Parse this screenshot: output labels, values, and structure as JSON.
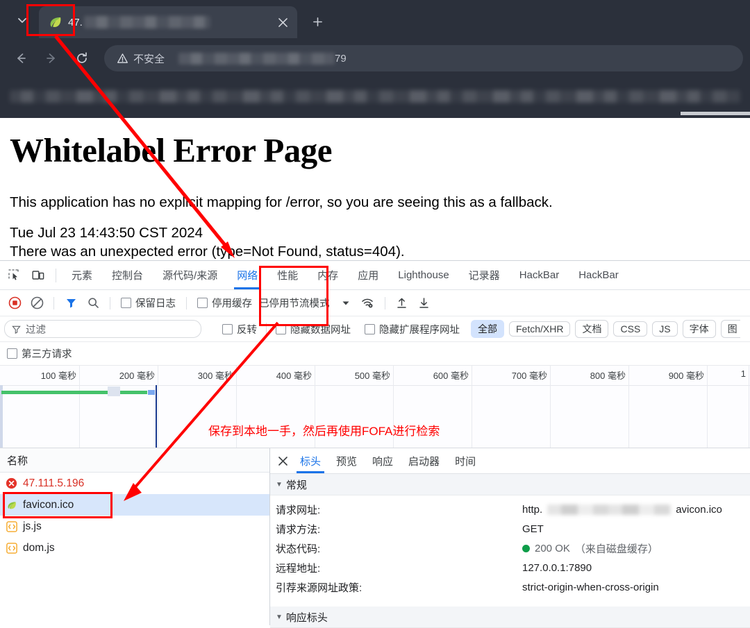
{
  "browser": {
    "tab": {
      "title_prefix": "47.",
      "favicon": "spring-leaf-icon",
      "close_icon": "close-icon"
    },
    "tab_search_icon": "chevron-down-icon",
    "new_tab_icon": "plus-icon",
    "nav": {
      "back_icon": "back-arrow-icon",
      "forward_icon": "forward-arrow-icon",
      "reload_icon": "reload-icon"
    },
    "omnibox": {
      "security_label": "不安全",
      "security_icon": "warning-triangle-icon",
      "url_suffix": "79"
    }
  },
  "page": {
    "heading": "Whitelabel Error Page",
    "line1": "This application has no explicit mapping for /error, so you are seeing this as a fallback.",
    "timestamp": "Tue Jul 23 14:43:50 CST 2024",
    "line2": "There was an unexpected error (type=Not Found, status=404)."
  },
  "devtools": {
    "inspect_icon": "inspect-element-icon",
    "device_icon": "device-toolbar-icon",
    "tabs": [
      {
        "label": "元素",
        "active": false
      },
      {
        "label": "控制台",
        "active": false
      },
      {
        "label": "源代码/来源",
        "active": false
      },
      {
        "label": "网络",
        "active": true
      },
      {
        "label": "性能",
        "active": false
      },
      {
        "label": "内存",
        "active": false
      },
      {
        "label": "应用",
        "active": false
      },
      {
        "label": "Lighthouse",
        "active": false
      },
      {
        "label": "记录器",
        "active": false
      },
      {
        "label": "HackBar",
        "active": false
      },
      {
        "label": "HackBar",
        "active": false
      }
    ],
    "toolbar": {
      "record_icon": "record-stop-icon",
      "clear_icon": "clear-icon",
      "filter_icon": "filter-funnel-icon",
      "search_icon": "search-icon",
      "preserve_log": "保留日志",
      "disable_cache": "停用缓存",
      "throttle_label": "已停用节流模式",
      "throttle_caret_icon": "chevron-down-icon",
      "network_conditions_icon": "wifi-gear-icon",
      "import_icon": "import-har-icon",
      "export_icon": "export-har-icon"
    },
    "filterbar": {
      "filter_placeholder": "过滤",
      "filter_icon": "filter-funnel-icon",
      "invert": "反转",
      "hide_data_urls": "隐藏数据网址",
      "hide_ext_urls": "隐藏扩展程序网址",
      "chips": [
        {
          "label": "全部",
          "active": true
        },
        {
          "label": "Fetch/XHR",
          "active": false
        },
        {
          "label": "文档",
          "active": false
        },
        {
          "label": "CSS",
          "active": false
        },
        {
          "label": "JS",
          "active": false
        },
        {
          "label": "字体",
          "active": false
        },
        {
          "label": "图",
          "active": false
        }
      ],
      "third_party": "第三方请求"
    },
    "overview": {
      "ticks": [
        "100 毫秒",
        "200 毫秒",
        "300 毫秒",
        "400 毫秒",
        "500 毫秒",
        "600 毫秒",
        "700 毫秒",
        "800 毫秒",
        "900 毫秒",
        "1"
      ]
    },
    "requests": {
      "column_name": "名称",
      "rows": [
        {
          "name": "47.111.5.196",
          "icon": "error-circle-icon",
          "state": "error",
          "selected": false
        },
        {
          "name": "favicon.ico",
          "icon": "spring-leaf-icon",
          "state": "ok",
          "selected": true
        },
        {
          "name": "js.js",
          "icon": "script-icon",
          "state": "ok",
          "selected": false
        },
        {
          "name": "dom.js",
          "icon": "script-icon",
          "state": "ok",
          "selected": false
        }
      ]
    },
    "detail": {
      "close_icon": "close-icon",
      "tabs": [
        {
          "label": "标头",
          "active": true
        },
        {
          "label": "预览",
          "active": false
        },
        {
          "label": "响应",
          "active": false
        },
        {
          "label": "启动器",
          "active": false
        },
        {
          "label": "时间",
          "active": false
        }
      ],
      "general_title": "常规",
      "rows": [
        {
          "key": "请求网址:",
          "value_prefix": "http.",
          "value_suffix": "avicon.ico",
          "redacted": true
        },
        {
          "key": "请求方法:",
          "value": "GET"
        },
        {
          "key": "状态代码:",
          "value": "200 OK",
          "note": "（来自磁盘缓存）",
          "status_dot": "#0e9d49"
        },
        {
          "key": "远程地址:",
          "value": "127.0.0.1:7890"
        },
        {
          "key": "引荐来源网址政策:",
          "value": "strict-origin-when-cross-origin"
        }
      ],
      "response_headers_title": "响应标头"
    }
  },
  "annotations": {
    "note_text": "保存到本地一手，然后再使用FOFA进行检索",
    "color": "#ff0000"
  }
}
